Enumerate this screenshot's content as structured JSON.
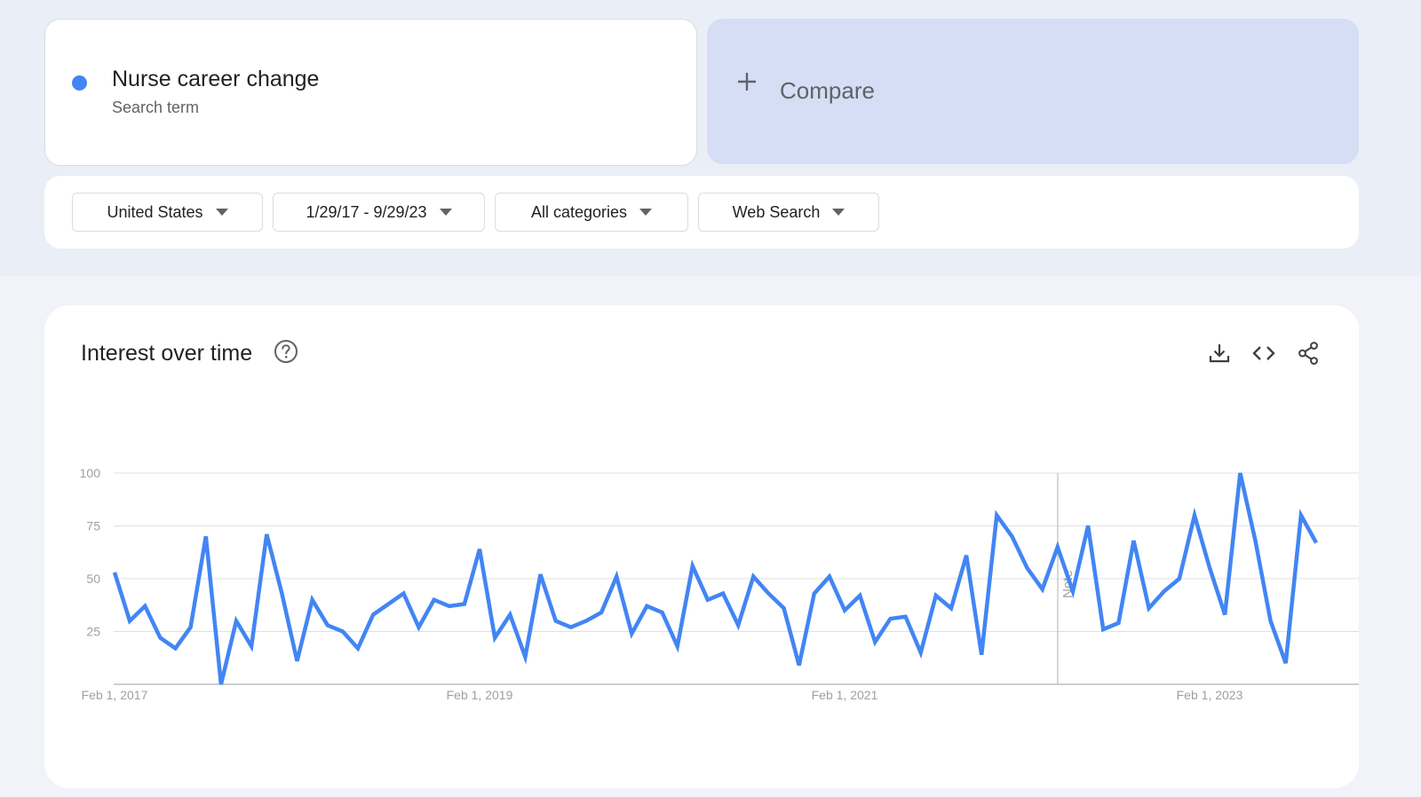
{
  "search_term": {
    "name": "Nurse career change",
    "subtitle": "Search term",
    "color": "#4285f4"
  },
  "compare": {
    "label": "Compare",
    "icon": "plus-icon"
  },
  "filters": [
    {
      "label": "United States",
      "icon": "caret-down-icon"
    },
    {
      "label": "1/29/17 - 9/29/23",
      "icon": "caret-down-icon"
    },
    {
      "label": "All categories",
      "icon": "caret-down-icon"
    },
    {
      "label": "Web Search",
      "icon": "caret-down-icon"
    }
  ],
  "chart_card": {
    "title": "Interest over time",
    "help_icon": "help-circle-icon",
    "tools": [
      "download-icon",
      "embed-code-icon",
      "share-icon"
    ],
    "note_label": "Note"
  },
  "chart_data": {
    "type": "line",
    "title": "Interest over time",
    "xlabel": "",
    "ylabel": "",
    "ylim": [
      0,
      100
    ],
    "y_ticks": [
      25,
      50,
      75,
      100
    ],
    "x_tick_labels": [
      "Feb 1, 2017",
      "Feb 1, 2019",
      "Feb 1, 2021",
      "Feb 1, 2023"
    ],
    "grid": true,
    "line_color": "#4285f4",
    "series": [
      {
        "values": [
          53,
          30,
          37,
          22,
          17,
          27,
          70,
          0,
          30,
          18,
          71,
          43,
          11,
          40,
          28,
          25,
          17,
          33,
          38,
          43,
          27,
          40,
          37,
          38,
          64,
          22,
          33,
          13,
          52,
          30,
          27,
          30,
          34,
          51,
          24,
          37,
          34,
          18,
          56,
          40,
          43,
          28,
          51,
          43,
          36,
          9,
          43,
          51,
          35,
          42,
          20,
          31,
          32,
          15,
          42,
          36,
          61,
          14,
          80,
          70,
          55,
          45,
          65,
          44,
          75,
          26,
          29,
          68,
          36,
          44,
          50,
          80,
          55,
          33,
          100,
          68,
          30,
          10,
          80,
          67
        ]
      }
    ]
  }
}
